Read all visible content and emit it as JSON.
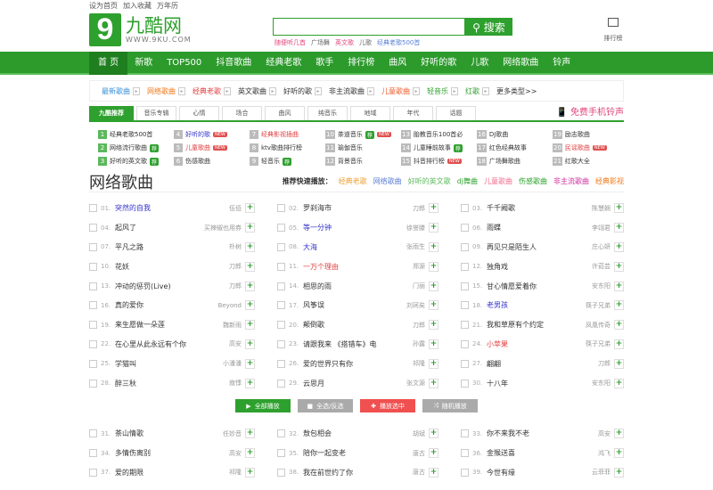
{
  "toplinks": [
    "设为首页",
    "加入收藏",
    "万年历"
  ],
  "logo": {
    "cn": "九酷网",
    "en": "WWW.9KU.COM"
  },
  "search": {
    "button": "搜索",
    "hints": [
      {
        "t": "随便听几首",
        "c": "#e0457b"
      },
      {
        "t": "广场舞",
        "c": "#666"
      },
      {
        "t": "英文歌",
        "c": "#e0457b"
      },
      {
        "t": "儿歌",
        "c": "#666"
      },
      {
        "t": "经典老歌500首",
        "c": "#5b7fd6"
      }
    ]
  },
  "rank_label": "排行榜",
  "nav": [
    "首 页",
    "新歌",
    "TOP500",
    "抖音歌曲",
    "经典老歌",
    "歌手",
    "排行榜",
    "曲风",
    "好听的歌",
    "儿歌",
    "网络歌曲",
    "铃声"
  ],
  "cats": [
    {
      "t": "最新歌曲",
      "c": "#3a8fd6"
    },
    {
      "t": "网络歌曲",
      "c": "#f07a1a"
    },
    {
      "t": "经典老歌",
      "c": "#e04040"
    },
    {
      "t": "英文歌曲",
      "c": "#333"
    },
    {
      "t": "好听的歌",
      "c": "#333"
    },
    {
      "t": "非主流歌曲",
      "c": "#333"
    },
    {
      "t": "儿童歌曲",
      "c": "#f06030"
    },
    {
      "t": "轻音乐",
      "c": "#2ea02e"
    },
    {
      "t": "红歌",
      "c": "#2ea02e"
    }
  ],
  "cats_more": "更多类型>>",
  "tabs": [
    "九酷推荐",
    "音乐专辑",
    "心情",
    "场合",
    "曲风",
    "纯音乐",
    "地域",
    "年代",
    "话题"
  ],
  "ring": "免费手机铃声",
  "rec": [
    {
      "n": "1",
      "t": "经典老歌500首",
      "c": "#333"
    },
    {
      "n": "4",
      "t": "好听的歌",
      "c": "#3333cc",
      "tag": "new"
    },
    {
      "n": "7",
      "t": "经典影视插曲",
      "c": "#e04040"
    },
    {
      "n": "10",
      "t": "茶道音乐",
      "c": "#333",
      "tag": "hotnew"
    },
    {
      "n": "13",
      "t": "胎教音乐100首必",
      "c": "#333"
    },
    {
      "n": "16",
      "t": "DJ歌曲",
      "c": "#333"
    },
    {
      "n": "19",
      "t": "励志歌曲",
      "c": "#333"
    },
    {
      "n": "2",
      "t": "网络流行歌曲",
      "c": "#333",
      "tag": "hot"
    },
    {
      "n": "5",
      "t": "儿童歌曲",
      "c": "#e04040",
      "tag": "new"
    },
    {
      "n": "8",
      "t": "ktv歌曲排行榜",
      "c": "#333"
    },
    {
      "n": "11",
      "t": "瑜伽音乐",
      "c": "#333"
    },
    {
      "n": "14",
      "t": "儿童睡前故事",
      "c": "#333",
      "tag": "hot"
    },
    {
      "n": "17",
      "t": "红色经典故事",
      "c": "#333"
    },
    {
      "n": "20",
      "t": "民谣歌曲",
      "c": "#e04040",
      "tag": "new"
    },
    {
      "n": "3",
      "t": "好听的英文歌",
      "c": "#333",
      "tag": "hot"
    },
    {
      "n": "6",
      "t": "伤感歌曲",
      "c": "#333"
    },
    {
      "n": "9",
      "t": "轻音乐",
      "c": "#333",
      "tag": "hot"
    },
    {
      "n": "12",
      "t": "背景音乐",
      "c": "#333"
    },
    {
      "n": "15",
      "t": "抖音排行榜",
      "c": "#333",
      "tag": "new"
    },
    {
      "n": "18",
      "t": "广场舞歌曲",
      "c": "#333"
    },
    {
      "n": "21",
      "t": "红歌大全",
      "c": "#333"
    }
  ],
  "tags": {
    "new": "NEW",
    "hot": "荐"
  },
  "title": "网络歌曲",
  "quick_label": "推荐快速播放：",
  "quick": [
    {
      "t": "经典老歌",
      "c": "#f0a030"
    },
    {
      "t": "网络歌曲",
      "c": "#5b7fd6"
    },
    {
      "t": "好听的英文歌",
      "c": "#5cb85c"
    },
    {
      "t": "dj舞曲",
      "c": "#2ea02e"
    },
    {
      "t": "儿童歌曲",
      "c": "#f07090"
    },
    {
      "t": "伤感歌曲",
      "c": "#2ea02e"
    },
    {
      "t": "非主流歌曲",
      "c": "#d030a0"
    },
    {
      "t": "经典影视",
      "c": "#f07a1a"
    }
  ],
  "songs1": [
    [
      "01.",
      "突然的自我",
      "伍佰",
      "#3333cc"
    ],
    [
      "02.",
      "罗刹海市",
      "刀郎",
      ""
    ],
    [
      "03.",
      "千千阙歌",
      "陈慧娴",
      ""
    ],
    [
      "04.",
      "起风了",
      "买辣椒也用券",
      ""
    ],
    [
      "05.",
      "等一分钟",
      "徐誉滕",
      "#3333cc"
    ],
    [
      "06.",
      "雨蝶",
      "李翊君",
      ""
    ],
    [
      "07.",
      "平凡之路",
      "朴树",
      ""
    ],
    [
      "08.",
      "大海",
      "张雨生",
      "#3333cc"
    ],
    [
      "09.",
      "再见只是陌生人",
      "庄心妍",
      ""
    ],
    [
      "10.",
      "花妖",
      "刀郎",
      ""
    ],
    [
      "11.",
      "一万个理由",
      "郑源",
      "#e04040"
    ],
    [
      "12.",
      "独角戏",
      "许茹芸",
      ""
    ],
    [
      "13.",
      "冲动的惩罚(Live)",
      "刀郎",
      ""
    ],
    [
      "14.",
      "相思的雨",
      "门丽",
      ""
    ],
    [
      "15.",
      "甘心情愿爱着你",
      "安东阳",
      ""
    ],
    [
      "16.",
      "真的爱你",
      "Beyond",
      ""
    ],
    [
      "17.",
      "风筝误",
      "刘珂矣",
      ""
    ],
    [
      "18.",
      "老男孩",
      "筷子兄弟",
      "#3333cc"
    ],
    [
      "19.",
      "来生愿做一朵莲",
      "魏新雨",
      ""
    ],
    [
      "20.",
      "颠倒歌",
      "刀郎",
      ""
    ],
    [
      "21.",
      "我和草原有个约定",
      "凤凰传奇",
      ""
    ],
    [
      "22.",
      "在心里从此永远有个你",
      "高安",
      ""
    ],
    [
      "23.",
      "请跟我来 《搭错车》电",
      "孙露",
      ""
    ],
    [
      "24.",
      "小苹果",
      "筷子兄弟",
      "#e04040"
    ],
    [
      "25.",
      "学猫叫",
      "小潘潘",
      ""
    ],
    [
      "26.",
      "爱的世界只有你",
      "祁隆",
      ""
    ],
    [
      "27.",
      "翩翩",
      "刀郎",
      ""
    ],
    [
      "28.",
      "醉三秋",
      "寂悸",
      ""
    ],
    [
      "29.",
      "云思月",
      "张文源",
      ""
    ],
    [
      "30.",
      "十八年",
      "安东阳",
      ""
    ]
  ],
  "buttons": [
    {
      "t": "全部播放",
      "c": "#2ea02e",
      "i": "▶"
    },
    {
      "t": "全选/反选",
      "c": "#aaa",
      "i": "■"
    },
    {
      "t": "播放选中",
      "c": "#f05050",
      "i": "✚"
    },
    {
      "t": "随机播放",
      "c": "#aaa",
      "i": "⤨"
    }
  ],
  "songs2": [
    [
      "31.",
      "茶山情歌",
      "任妙音",
      ""
    ],
    [
      "32.",
      "敖包相会",
      "胡斌",
      ""
    ],
    [
      "33.",
      "你不来我不老",
      "高安",
      ""
    ],
    [
      "34.",
      "多情伤离别",
      "高安",
      ""
    ],
    [
      "35.",
      "陪你一起变老",
      "唐古",
      ""
    ],
    [
      "36.",
      "金猴送喜",
      "鸿飞",
      ""
    ],
    [
      "37.",
      "爱的期限",
      "祁隆",
      ""
    ],
    [
      "38.",
      "我在前世约了你",
      "唐古",
      ""
    ],
    [
      "39.",
      "今世有缘",
      "云菲菲",
      ""
    ]
  ]
}
